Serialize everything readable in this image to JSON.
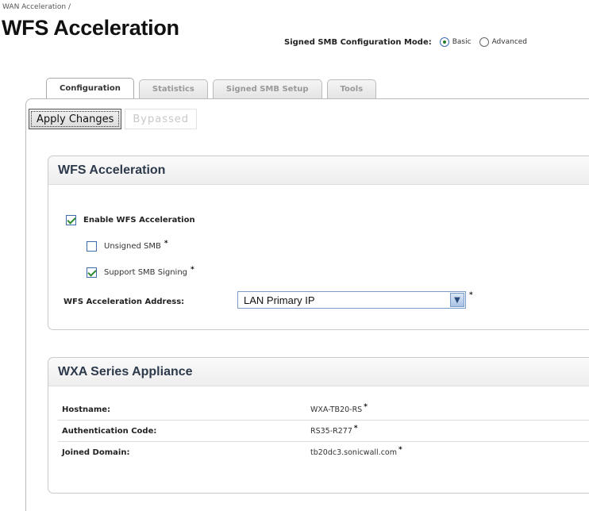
{
  "breadcrumb": "WAN Acceleration /",
  "page_title": "WFS Acceleration",
  "smb_mode": {
    "label": "Signed SMB Configuration Mode:",
    "options": [
      {
        "label": "Basic",
        "selected": true
      },
      {
        "label": "Advanced",
        "selected": false
      }
    ]
  },
  "tabs": [
    {
      "label": "Configuration",
      "active": true
    },
    {
      "label": "Statistics",
      "active": false
    },
    {
      "label": "Signed SMB Setup",
      "active": false
    },
    {
      "label": "Tools",
      "active": false
    }
  ],
  "buttons": {
    "apply": "Apply Changes",
    "bypassed": "Bypassed"
  },
  "wfs_panel": {
    "title": "WFS Acceleration",
    "enable": {
      "label": "Enable WFS Acceleration",
      "checked": true
    },
    "unsigned_smb": {
      "label": "Unsigned SMB",
      "checked": false
    },
    "support_signing": {
      "label": "Support SMB Signing",
      "checked": true
    },
    "address_label": "WFS Acceleration Address:",
    "address_value": "LAN Primary IP"
  },
  "wxa_panel": {
    "title": "WXA Series Appliance",
    "rows": [
      {
        "label": "Hostname:",
        "value": "WXA-TB20-RS"
      },
      {
        "label": "Authentication Code:",
        "value": "RS35-R277"
      },
      {
        "label": "Joined Domain:",
        "value": "tb20dc3.sonicwall.com"
      }
    ]
  },
  "asterisk": "*",
  "colors": {
    "check_green": "#2e8b2e",
    "panel_title": "#2d3a4b",
    "select_border": "#7a9cc8"
  }
}
